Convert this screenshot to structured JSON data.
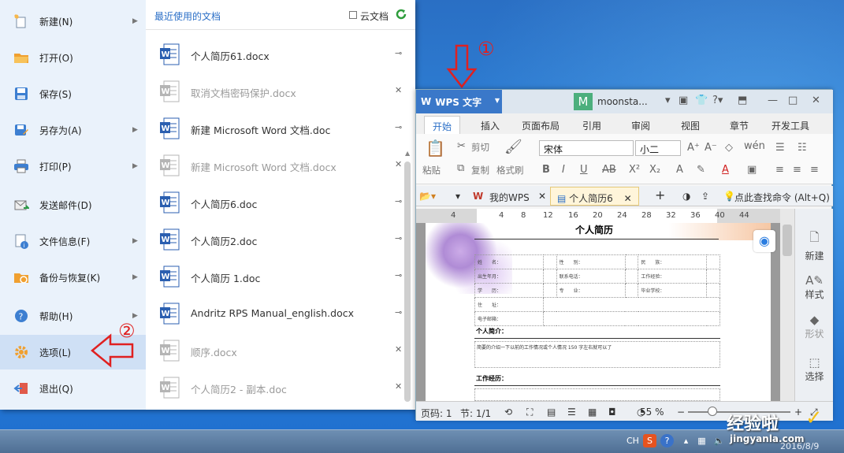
{
  "file_menu": {
    "items": [
      {
        "label": "新建(N)",
        "icon": "new-file-icon",
        "arrow": true
      },
      {
        "label": "打开(O)",
        "icon": "open-folder-icon",
        "arrow": false
      },
      {
        "label": "保存(S)",
        "icon": "save-icon",
        "arrow": false
      },
      {
        "label": "另存为(A)",
        "icon": "save-as-icon",
        "arrow": true
      },
      {
        "label": "打印(P)",
        "icon": "print-icon",
        "arrow": true
      },
      {
        "label": "发送邮件(D)",
        "icon": "mail-icon",
        "arrow": false
      },
      {
        "label": "文件信息(F)",
        "icon": "file-info-icon",
        "arrow": true
      },
      {
        "label": "备份与恢复(K)",
        "icon": "backup-icon",
        "arrow": true
      },
      {
        "label": "帮助(H)",
        "icon": "help-icon",
        "arrow": true
      },
      {
        "label": "选项(L)",
        "icon": "gear-icon",
        "arrow": false,
        "active": true
      },
      {
        "label": "退出(Q)",
        "icon": "exit-icon",
        "arrow": false
      }
    ],
    "recent_title": "最近使用的文档",
    "cloud_docs_label": "云文档",
    "recent_docs": [
      {
        "name": "个人简历61.docx",
        "greyed": false,
        "action": "pin"
      },
      {
        "name": "取消文档密码保护.docx",
        "greyed": true,
        "action": "close"
      },
      {
        "name": "新建 Microsoft Word 文档.doc",
        "greyed": false,
        "action": "pin"
      },
      {
        "name": "新建 Microsoft Word 文档.docx",
        "greyed": true,
        "action": "close"
      },
      {
        "name": "个人简历6.doc",
        "greyed": false,
        "action": "pin"
      },
      {
        "name": "个人简历2.doc",
        "greyed": false,
        "action": "pin"
      },
      {
        "name": "个人简历 1.doc",
        "greyed": false,
        "action": "pin"
      },
      {
        "name": "Andritz RPS Manual_english.docx",
        "greyed": false,
        "action": "pin"
      },
      {
        "name": "顺序.docx",
        "greyed": true,
        "action": "close"
      },
      {
        "name": "个人简历2 - 副本.doc",
        "greyed": true,
        "action": "close"
      }
    ]
  },
  "annotations": {
    "one": "①",
    "two": "②"
  },
  "wps": {
    "app_name": "WPS 文字",
    "account_initial": "M",
    "account_name": "moonsta...",
    "ribbon_tabs": [
      "开始",
      "插入",
      "页面布局",
      "引用",
      "审阅",
      "视图",
      "章节",
      "开发工具"
    ],
    "clipboard": {
      "cut": "剪切",
      "copy": "复制",
      "paste": "粘贴",
      "format_painter": "格式刷"
    },
    "font_name": "宋体",
    "font_size": "小二",
    "doc_tabs": {
      "home": "我的WPS",
      "doc": "个人简历6"
    },
    "search_hint": "点此查找命令 (Alt+Q)",
    "ruler_numbers": [
      "4",
      "4",
      "8",
      "12",
      "16",
      "20",
      "24",
      "28",
      "32",
      "36",
      "40",
      "44"
    ],
    "page": {
      "title": "个人简历",
      "form_rows": [
        [
          "姓　　名：",
          "",
          "性　　别：",
          "",
          "民　　族：",
          ""
        ],
        [
          "出生年月：",
          "",
          "联系电话：",
          "",
          "工作经验：",
          ""
        ],
        [
          "学　　历：",
          "",
          "专　　业：",
          "",
          "毕业学校：",
          ""
        ],
        [
          "住　　址：",
          "",
          "",
          "",
          "",
          ""
        ],
        [
          "电子邮箱：",
          "",
          "",
          "",
          "",
          ""
        ]
      ],
      "intro_title": "个人简介：",
      "intro_text": "简要的介绍一下以前的工作情况或个人情况 150 字左右就可以了",
      "work_title": "工作经历："
    },
    "side_panel": [
      "新建",
      "样式",
      "形状",
      "选择"
    ],
    "status": {
      "page": "页码: 1",
      "section": "节: 1/1",
      "zoom": "55 %"
    }
  },
  "taskbar": {
    "lang": "CH",
    "date": "2016/8/9"
  },
  "watermark": {
    "text": "经验啦",
    "check": "✓",
    "url": "jingyanla.com"
  }
}
